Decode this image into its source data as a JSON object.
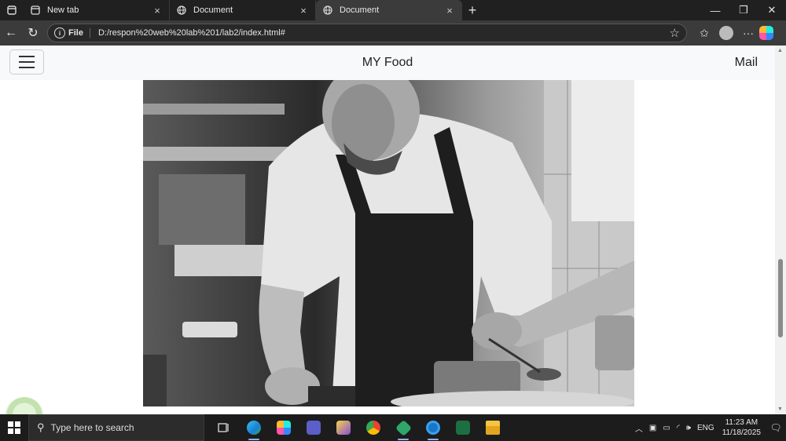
{
  "browser": {
    "tabs": [
      {
        "title": "New tab",
        "active": false,
        "icon": "newtab-icon"
      },
      {
        "title": "Document",
        "active": false,
        "icon": "globe-icon"
      },
      {
        "title": "Document",
        "active": true,
        "icon": "globe-icon"
      }
    ],
    "close_glyph": "×",
    "address": {
      "scheme_label": "File",
      "url": "D:/respon%20web%20lab%201/lab2/index.html#"
    }
  },
  "site": {
    "brand": "MY Food",
    "nav_link": "Mail",
    "hero_image": "chef-plating-photo"
  },
  "taskbar": {
    "search_placeholder": "Type here to search",
    "apps": [
      "task-view",
      "edge",
      "copilot",
      "teams",
      "snip",
      "chrome",
      "app-green",
      "app-blue",
      "excel",
      "file-explorer"
    ],
    "tray": {
      "language": "ENG",
      "time": "11:23 AM",
      "date": "11/18/2025"
    }
  }
}
